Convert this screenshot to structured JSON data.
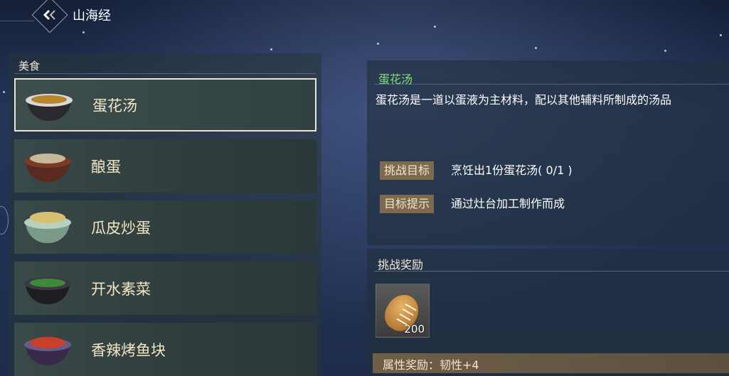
{
  "header": {
    "back_icon": "chevron-left-icon",
    "title": "山海经"
  },
  "category": {
    "label": "美食"
  },
  "items": [
    {
      "label": "蛋花汤",
      "icon": "egg-drop-soup-icon",
      "selected": true
    },
    {
      "label": "酿蛋",
      "icon": "stuffed-egg-icon",
      "selected": false
    },
    {
      "label": "瓜皮炒蛋",
      "icon": "melon-rind-egg-icon",
      "selected": false
    },
    {
      "label": "开水素菜",
      "icon": "vegetable-soup-icon",
      "selected": false
    },
    {
      "label": "香辣烤鱼块",
      "icon": "spicy-fish-icon",
      "selected": false
    }
  ],
  "detail": {
    "title": "蛋花汤",
    "description": "蛋花汤是一道以蛋液为主材料，配以其他辅料所制成的汤品",
    "challenge_tag": "挑战目标",
    "challenge_value": "烹饪出1份蛋花汤( 0/1 )",
    "hint_tag": "目标提示",
    "hint_value": "通过灶台加工制作而成"
  },
  "reward": {
    "title": "挑战奖励",
    "item_icon": "bread-icon",
    "item_count": "200",
    "attribute": "属性奖励：韧性+4"
  },
  "colors": {
    "title_green": "#7fe07a",
    "tag_bg": "#7d6a4e",
    "item_text": "#f2e6c4"
  }
}
